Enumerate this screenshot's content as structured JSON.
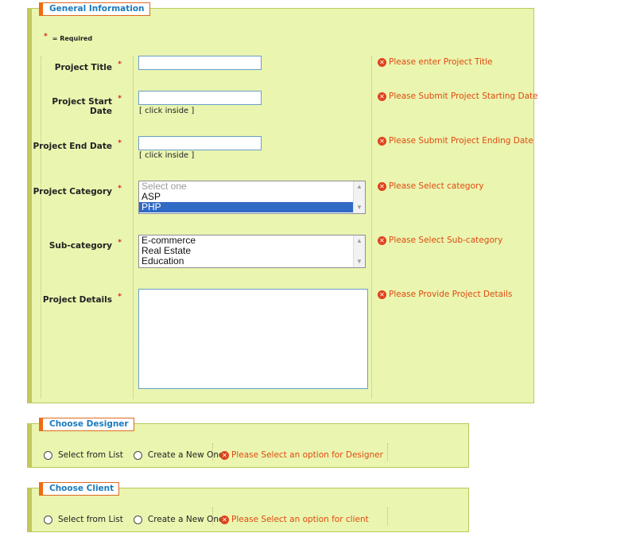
{
  "general": {
    "legend": "General Information",
    "required_note": "= Required",
    "required_mark": "*",
    "fields": {
      "title": {
        "label": "Project Title",
        "error": "Please enter Project Title",
        "value": ""
      },
      "start": {
        "label": "Project Start Date",
        "hint": "[ click inside ]",
        "error": "Please Submit Project Starting Date",
        "value": ""
      },
      "end": {
        "label": "Project End Date",
        "hint": "[ click inside ]",
        "error": "Please Submit Project Ending Date",
        "value": ""
      },
      "category": {
        "label": "Project Category",
        "error": "Please Select category",
        "options": [
          "Select one",
          "ASP",
          "PHP"
        ],
        "selected": "PHP"
      },
      "subcategory": {
        "label": "Sub-category",
        "error": "Please Select Sub-category",
        "options": [
          "E-commerce",
          "Real Estate",
          "Education"
        ]
      },
      "details": {
        "label": "Project Details",
        "error": "Please Provide Project Details",
        "value": ""
      }
    }
  },
  "designer": {
    "legend": "Choose Designer",
    "option_list": "Select from List",
    "option_new": "Create a New One",
    "error": "Please Select an option for Designer"
  },
  "client": {
    "legend": "Choose Client",
    "option_list": "Select from List",
    "option_new": "Create a New One",
    "error": "Please Select an option for client"
  },
  "icons": {
    "error": "error-x-icon",
    "scroll_up": "scroll-up-icon",
    "scroll_down": "scroll-down-icon"
  },
  "colors": {
    "panel_bg": "#eaf5b0",
    "panel_border": "#bcc85d",
    "legend_accent": "#f26a10",
    "legend_text": "#1b7bbf",
    "error_text": "#e04a0f",
    "selected": "#316ac5"
  }
}
